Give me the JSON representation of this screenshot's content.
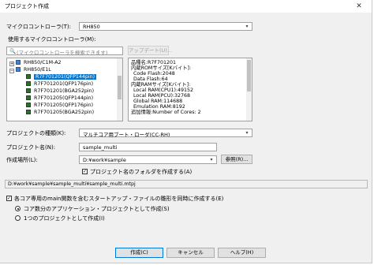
{
  "dialog": {
    "title": "プロジェクト作成",
    "close_glyph": "✕"
  },
  "mcu": {
    "label": "マイクロコントローラ(T):",
    "value": "RH850",
    "use_label": "使用するマイクロコントローラ(M):",
    "search_placeholder": "(マイクロコントローラを検索できます)",
    "update_button": "アップデート(U)..."
  },
  "tree": {
    "items": [
      {
        "label": "RH850/C1M-A2",
        "level": 0,
        "expander": "+",
        "group": true,
        "selected": false
      },
      {
        "label": "RH850/E1L",
        "level": 0,
        "expander": "−",
        "group": true,
        "selected": false
      },
      {
        "label": "R7F701201(QFP144pin)",
        "level": 1,
        "selected": true
      },
      {
        "label": "R7F701201(QFP176pin)",
        "level": 1,
        "selected": false
      },
      {
        "label": "R7F701201(BGA252pin)",
        "level": 1,
        "selected": false
      },
      {
        "label": "R7F701205(QFP144pin)",
        "level": 1,
        "selected": false
      },
      {
        "label": "R7F701205(QFP176pin)",
        "level": 1,
        "selected": false
      },
      {
        "label": "R7F701205(BGA252pin)",
        "level": 1,
        "selected": false
      }
    ]
  },
  "details": {
    "lines": [
      "品種名:R7F701201",
      "内蔵ROMサイズ[Kバイト]:",
      "  Code Flash:2048",
      "  Data Flash:64",
      "内蔵RAMサイズ[Kバイト]:",
      "  Local RAM(CPU1):49152",
      "  Local RAM(PCU):32768",
      "  Global RAM:114688",
      "  Emulation RAM:8192",
      "追加情報:Number of Cores: 2"
    ]
  },
  "project": {
    "type_label": "プロジェクトの種類(K):",
    "type_value": "マルチコア用ブート・ローダ(CC-RH)",
    "name_label": "プロジェクト名(N):",
    "name_value": "sample_multi",
    "location_label": "作成場所(L):",
    "location_value": "D:¥work¥sample",
    "browse_button": "参照(R)...",
    "make_folder_label": "プロジェクト名のフォルダを作成する(A)",
    "path": "D:¥work¥sample¥sample_multi¥sample_multi.mtpj"
  },
  "options": {
    "main_label": "各コア専用のmain関数を含むスタートアップ・ファイルの雛形を同時に作成する(E)",
    "radio_app": "コア数分のアプリケーション・プロジェクトとして作成(S)",
    "radio_single": "1つのプロジェクトとして作成(I)"
  },
  "buttons": {
    "create": "作成(C)",
    "cancel": "キャンセル",
    "help": "ヘルプ(H)"
  }
}
